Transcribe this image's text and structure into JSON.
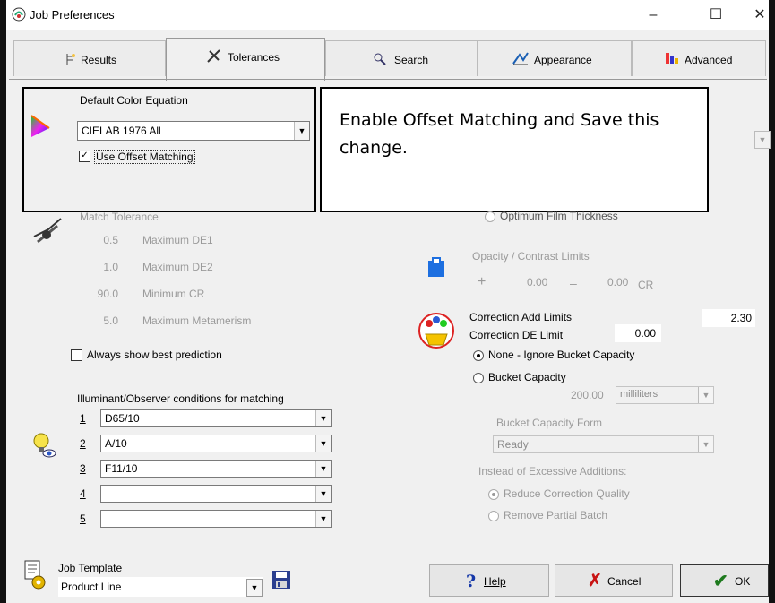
{
  "window": {
    "title": "Job Preferences",
    "minimize": "–",
    "maximize": "☐",
    "close": "✕"
  },
  "tabs": [
    {
      "label": "Results"
    },
    {
      "label": "Tolerances"
    },
    {
      "label": "Search"
    },
    {
      "label": "Appearance"
    },
    {
      "label": "Advanced"
    }
  ],
  "color_equation": {
    "label": "Default Color Equation",
    "value": "CIELAB 1976  All",
    "offset_label": "Use Offset Matching",
    "offset_checked": "✓"
  },
  "instruction": "Enable Offset Matching and Save this change.",
  "match_tolerance": {
    "label": "Match Tolerance",
    "rows": [
      {
        "value": "0.5",
        "label": "Maximum DE1"
      },
      {
        "value": "1.0",
        "label": "Maximum DE2"
      },
      {
        "value": "90.0",
        "label": "Minimum CR"
      },
      {
        "value": "5.0",
        "label": "Maximum Metamerism"
      }
    ]
  },
  "always_show": "Always show best prediction",
  "illuminant": {
    "label": "Illuminant/Observer conditions for matching",
    "rows": [
      {
        "num": "1",
        "value": "D65/10"
      },
      {
        "num": "2",
        "value": "A/10"
      },
      {
        "num": "3",
        "value": "F11/10"
      },
      {
        "num": "4",
        "value": ""
      },
      {
        "num": "5",
        "value": ""
      }
    ]
  },
  "film": {
    "label": "Optimum Film Thickness"
  },
  "opacity": {
    "label": "Opacity / Contrast Limits",
    "plus": "+",
    "min": "0.00",
    "minus": "–",
    "max": "0.00",
    "unit": "CR"
  },
  "correction": {
    "add_label": "Correction Add Limits",
    "add_value": "2.30",
    "de_label": "Correction DE Limit",
    "de_value": "0.00"
  },
  "bucket": {
    "none_label": "None - Ignore Bucket Capacity",
    "capacity_label": "Bucket Capacity",
    "amount": "200.00",
    "unit": "milliliters",
    "form_label": "Bucket Capacity Form",
    "form_value": "Ready",
    "excess_label": "Instead of Excessive Additions:",
    "reduce_label": "Reduce Correction Quality",
    "remove_label": "Remove Partial Batch"
  },
  "footer": {
    "template_label": "Job Template",
    "template_value": "Product Line",
    "help": "Help",
    "cancel": "Cancel",
    "ok": "OK"
  }
}
